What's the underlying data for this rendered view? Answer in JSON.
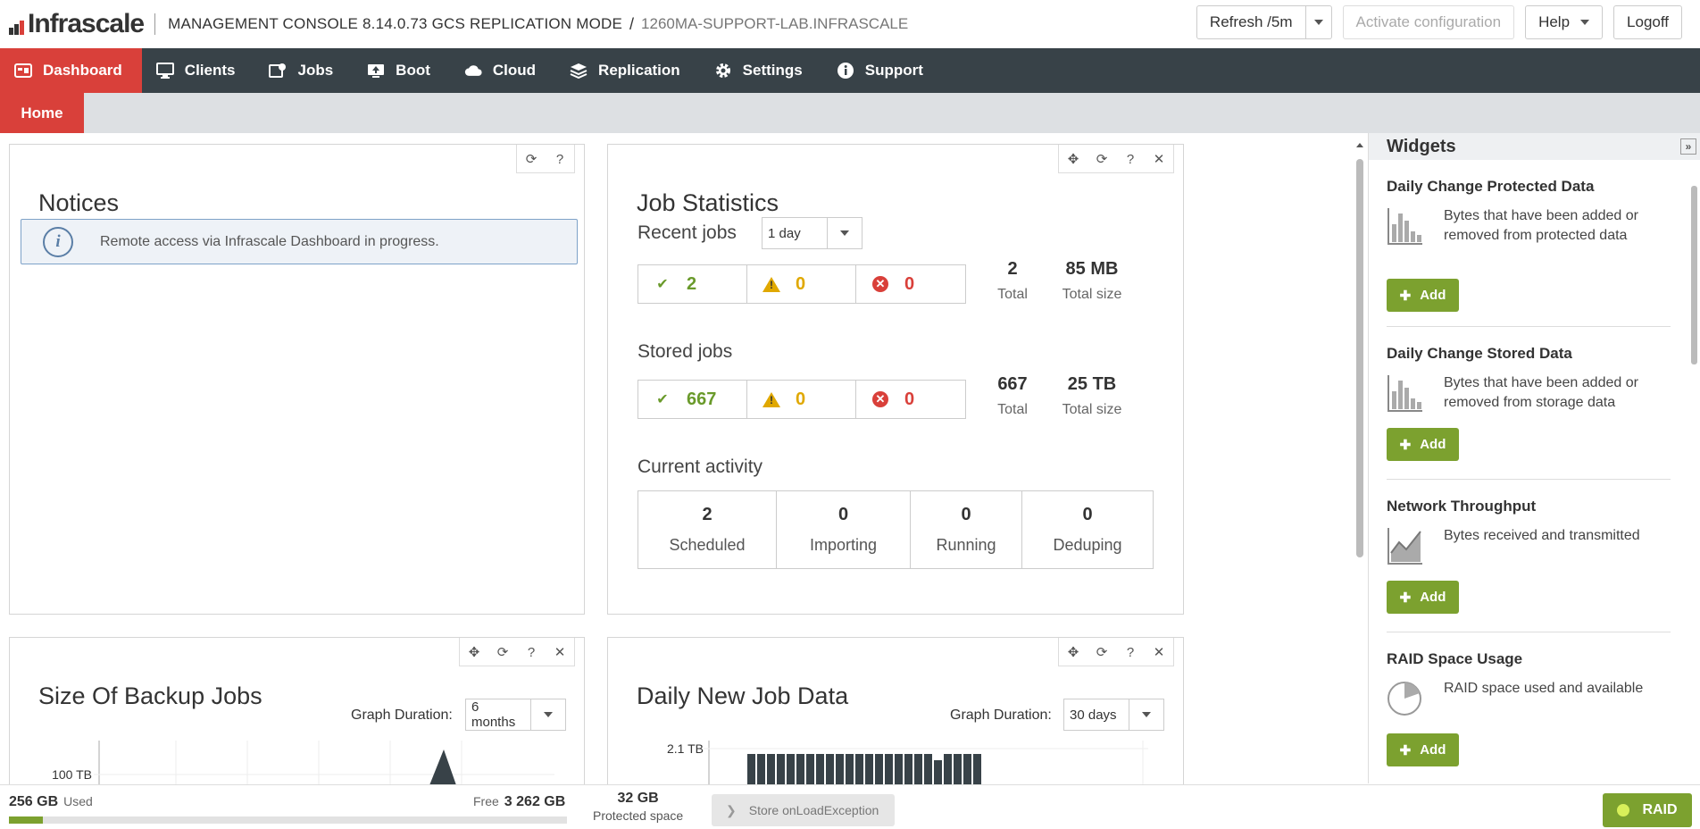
{
  "header": {
    "logo_text": "Infrascale",
    "console_title": "MANAGEMENT CONSOLE 8.14.0.73 GCS REPLICATION MODE",
    "separator": "/",
    "host": "1260MA-SUPPORT-LAB.INFRASCALE",
    "refresh_label": "Refresh /5m",
    "activate_label": "Activate configuration",
    "help_label": "Help",
    "logoff_label": "Logoff"
  },
  "nav": {
    "items": [
      {
        "label": "Dashboard",
        "icon": "dashboard-icon"
      },
      {
        "label": "Clients",
        "icon": "monitor-icon"
      },
      {
        "label": "Jobs",
        "icon": "jobs-icon"
      },
      {
        "label": "Boot",
        "icon": "boot-icon"
      },
      {
        "label": "Cloud",
        "icon": "cloud-icon"
      },
      {
        "label": "Replication",
        "icon": "replication-icon"
      },
      {
        "label": "Settings",
        "icon": "gear-icon"
      },
      {
        "label": "Support",
        "icon": "info-icon"
      }
    ]
  },
  "subtabs": {
    "home": "Home"
  },
  "notices": {
    "title": "Notices",
    "message": "Remote access via Infrascale Dashboard in progress."
  },
  "job_stats": {
    "title": "Job Statistics",
    "recent_label": "Recent jobs",
    "recent_period": "1 day",
    "recent": {
      "ok": "2",
      "warn": "0",
      "err": "0",
      "total": "2",
      "total_label": "Total",
      "size": "85 MB",
      "size_label": "Total size"
    },
    "stored_label": "Stored jobs",
    "stored": {
      "ok": "667",
      "warn": "0",
      "err": "0",
      "total": "667",
      "total_label": "Total",
      "size": "25 TB",
      "size_label": "Total size"
    },
    "activity_label": "Current activity",
    "activity": [
      {
        "value": "2",
        "label": "Scheduled"
      },
      {
        "value": "0",
        "label": "Importing"
      },
      {
        "value": "0",
        "label": "Running"
      },
      {
        "value": "0",
        "label": "Deduping"
      }
    ]
  },
  "backup_size": {
    "title": "Size Of Backup Jobs",
    "duration_label": "Graph Duration:",
    "duration_value": "6 months",
    "y_tick": "100 TB"
  },
  "daily_new": {
    "title": "Daily New Job Data",
    "duration_label": "Graph Duration:",
    "duration_value": "30 days",
    "y_tick": "2.1 TB"
  },
  "widgets": {
    "title": "Widgets",
    "add_label": "Add",
    "items": [
      {
        "title": "Daily Change Protected Data",
        "desc": "Bytes that have been added or removed from protected data",
        "icon": "bar-chart-icon"
      },
      {
        "title": "Daily Change Stored Data",
        "desc": "Bytes that have been added or removed from storage data",
        "icon": "bar-chart-icon"
      },
      {
        "title": "Network Throughput",
        "desc": "Bytes received and transmitted",
        "icon": "line-chart-icon"
      },
      {
        "title": "RAID Space Usage",
        "desc": "RAID space used and available",
        "icon": "pie-chart-icon"
      }
    ]
  },
  "footer": {
    "used_value": "256 GB",
    "used_label": "Used",
    "free_label": "Free",
    "free_value": "3 262 GB",
    "used_fraction": 0.06,
    "protected_value": "32 GB",
    "protected_label": "Protected space",
    "store_label": "Store onLoadException",
    "raid_label": "RAID"
  },
  "colors": {
    "brand_red": "#d9403a",
    "nav_bg": "#384248",
    "ok_green": "#6a9a2b",
    "warn_yellow": "#e0a800",
    "add_green": "#7ca12f"
  }
}
